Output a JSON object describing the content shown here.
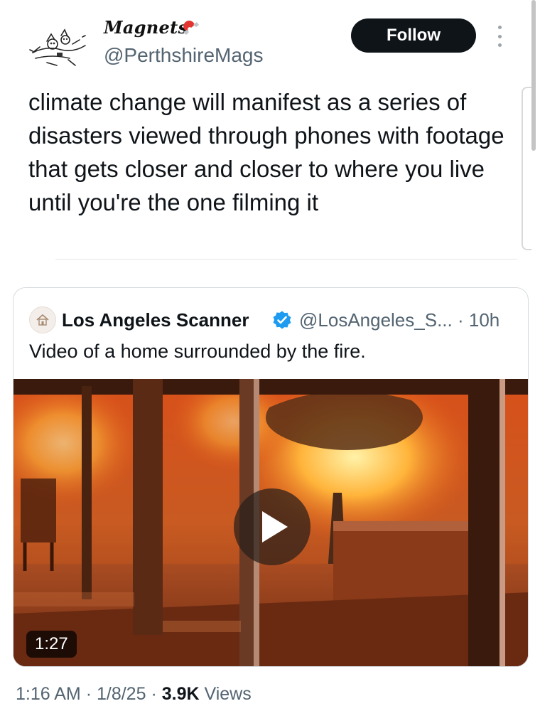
{
  "author": {
    "display_name": "Magnets",
    "handle": "@PerthshireMags",
    "follow_label": "Follow"
  },
  "tweet": {
    "text": "climate change will manifest as a series of disasters viewed through phones with footage that gets closer and closer to where you live until you're the one filming it"
  },
  "quote": {
    "name": "Los Angeles Scanner",
    "handle": "@LosAngeles_S...",
    "separator": "·",
    "time": "10h",
    "text": "Video of a home surrounded by the fire.",
    "video_duration": "1:27"
  },
  "footer": {
    "time": "1:16 AM",
    "sep1": "·",
    "date": "1/8/25",
    "sep2": "·",
    "views_count": "3.9K",
    "views_label": "Views"
  },
  "colors": {
    "follow_bg": "#0f1419",
    "verified": "#1d9bf0",
    "secondary_text": "#536471"
  },
  "icons": [
    "magnet-icon",
    "more-icon",
    "verified-icon",
    "play-icon"
  ]
}
